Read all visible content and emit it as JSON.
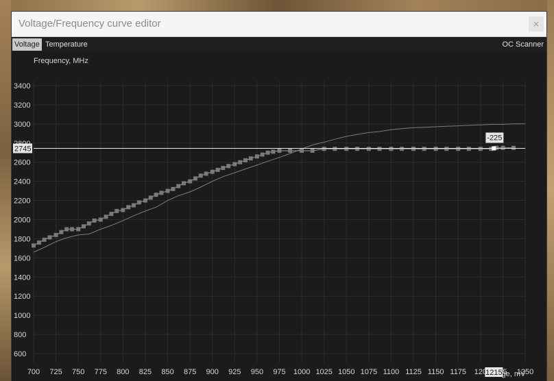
{
  "window": {
    "title": "Voltage/Frequency curve editor",
    "close_glyph": "×"
  },
  "tabs": [
    {
      "label": "Voltage",
      "active": true
    },
    {
      "label": "Temperature",
      "active": false
    }
  ],
  "oc_scanner_label": "OC Scanner",
  "colors": {
    "background": "#1b1b1d",
    "grid": "#2c2c2e",
    "curve": "#9a9a9a",
    "point": "#7a7a7a",
    "cursor": "#ffffff"
  },
  "chart_data": {
    "type": "line",
    "ylabel": "Frequency, MHz",
    "xlabel": "Voltage, mV",
    "xlim": [
      700,
      1250
    ],
    "ylim": [
      500,
      3450
    ],
    "x_ticks": [
      700,
      725,
      750,
      775,
      800,
      825,
      850,
      875,
      900,
      925,
      950,
      975,
      1000,
      1025,
      1050,
      1075,
      1100,
      1125,
      1150,
      1175,
      1200,
      1225,
      1250
    ],
    "x_tick_labels": [
      "700",
      "725",
      "750",
      "775",
      "800",
      "825",
      "850",
      "875",
      "900",
      "925",
      "950",
      "975",
      "1000",
      "1025",
      "1050",
      "1075",
      "1100",
      "1125",
      "1150",
      "1175",
      "120",
      "25",
      "1250"
    ],
    "y_ticks": [
      600,
      800,
      1000,
      1200,
      1400,
      1600,
      1800,
      2000,
      2200,
      2400,
      2600,
      2800,
      3000,
      3200,
      3400
    ],
    "y_tick_labels": [
      "600",
      "800",
      "1000",
      "1200",
      "1400",
      "1600",
      "1800",
      "2000",
      "2200",
      "2400",
      "2600",
      "2800",
      "3000",
      "3200",
      "3400"
    ],
    "grid": true,
    "cursor": {
      "voltage": 1215,
      "frequency": 2745,
      "voltage_label": "1215",
      "frequency_label": "2745",
      "offset_label": "-225"
    },
    "series": [
      {
        "role": "edited-curve",
        "x": [
          700,
          706,
          712,
          718,
          725,
          731,
          737,
          743,
          750,
          756,
          762,
          768,
          775,
          781,
          787,
          793,
          800,
          806,
          812,
          818,
          825,
          831,
          837,
          843,
          850,
          856,
          862,
          868,
          875,
          881,
          887,
          893,
          900,
          906,
          912,
          918,
          925,
          931,
          937,
          943,
          950,
          956,
          962,
          968,
          975,
          987,
          1000,
          1012,
          1025,
          1037,
          1050,
          1062,
          1075,
          1087,
          1100,
          1112,
          1125,
          1137,
          1150,
          1162,
          1175,
          1187,
          1200,
          1212,
          1218,
          1225,
          1237
        ],
        "y": [
          1730,
          1760,
          1790,
          1815,
          1840,
          1870,
          1900,
          1900,
          1900,
          1930,
          1960,
          1990,
          2000,
          2030,
          2060,
          2090,
          2100,
          2130,
          2150,
          2180,
          2200,
          2230,
          2260,
          2280,
          2300,
          2320,
          2350,
          2380,
          2400,
          2430,
          2460,
          2480,
          2500,
          2520,
          2540,
          2560,
          2580,
          2600,
          2620,
          2640,
          2660,
          2680,
          2700,
          2710,
          2720,
          2720,
          2720,
          2720,
          2740,
          2740,
          2740,
          2740,
          2740,
          2740,
          2740,
          2740,
          2740,
          2740,
          2740,
          2740,
          2740,
          2740,
          2740,
          2740,
          2750,
          2750,
          2750
        ]
      },
      {
        "role": "default-curve",
        "x": [
          700,
          712,
          725,
          737,
          750,
          762,
          775,
          787,
          800,
          812,
          825,
          837,
          850,
          862,
          875,
          887,
          900,
          912,
          925,
          937,
          950,
          962,
          975,
          987,
          1000,
          1012,
          1025,
          1037,
          1050,
          1062,
          1075,
          1087,
          1100,
          1112,
          1125,
          1137,
          1150,
          1162,
          1175,
          1187,
          1200,
          1212,
          1225,
          1237,
          1250
        ],
        "y": [
          1660,
          1710,
          1770,
          1810,
          1840,
          1850,
          1900,
          1940,
          1990,
          2040,
          2090,
          2130,
          2200,
          2250,
          2290,
          2340,
          2400,
          2450,
          2490,
          2530,
          2570,
          2610,
          2650,
          2690,
          2740,
          2780,
          2810,
          2840,
          2870,
          2890,
          2910,
          2920,
          2940,
          2950,
          2960,
          2965,
          2970,
          2975,
          2980,
          2985,
          2990,
          2995,
          2995,
          3000,
          3000
        ]
      }
    ]
  }
}
